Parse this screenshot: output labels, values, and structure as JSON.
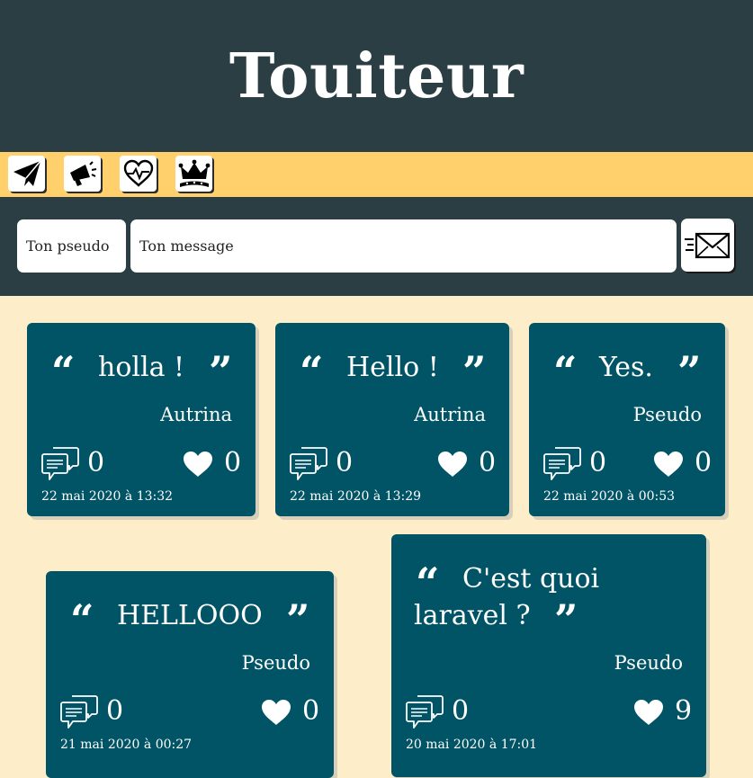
{
  "header": {
    "title": "Touiteur"
  },
  "nav": [
    {
      "icon": "paper-plane-icon",
      "label": "send"
    },
    {
      "icon": "megaphone-icon",
      "label": "announce"
    },
    {
      "icon": "heartbeat-icon",
      "label": "popular"
    },
    {
      "icon": "crown-icon",
      "label": "top"
    }
  ],
  "form": {
    "pseudo_placeholder": "Ton pseudo",
    "message_placeholder": "Ton message",
    "send_icon": "envelope-send-icon"
  },
  "colors": {
    "header_bg": "#2b3e44",
    "nav_bg": "#ffd06b",
    "page_bg": "#fdedc9",
    "card_bg": "#005465"
  },
  "touites": [
    {
      "message": "holla !",
      "author": "Autrina",
      "comments": "0",
      "likes": "0",
      "date": "22 mai 2020 à 13:32"
    },
    {
      "message": "Hello !",
      "author": "Autrina",
      "comments": "0",
      "likes": "0",
      "date": "22 mai 2020 à 13:29"
    },
    {
      "message": "Yes.",
      "author": "Pseudo",
      "comments": "0",
      "likes": "0",
      "date": "22 mai 2020 à 00:53"
    },
    {
      "message": "HELLOOO",
      "author": "Pseudo",
      "comments": "0",
      "likes": "0",
      "date": "21 mai 2020 à 00:27"
    },
    {
      "message_line1": "C'est quoi",
      "message_line2": "laravel ?",
      "author": "Pseudo",
      "comments": "0",
      "likes": "9",
      "date": "20 mai 2020 à 17:01"
    }
  ]
}
